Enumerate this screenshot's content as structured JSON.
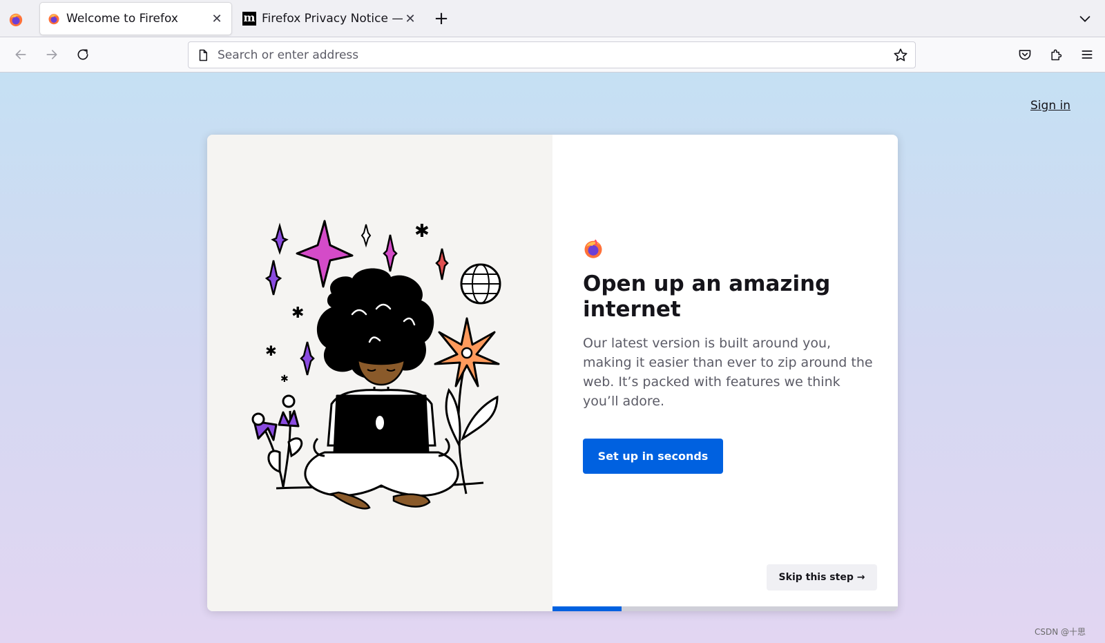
{
  "tabs": [
    {
      "title": "Welcome to Firefox",
      "favicon": "firefox-icon",
      "active": true
    },
    {
      "title": "Firefox Privacy Notice — Mozilla",
      "favicon": "mozilla-m-icon",
      "favicon_text": "m",
      "active": false
    }
  ],
  "toolbar": {
    "address_placeholder": "Search or enter address"
  },
  "page": {
    "sign_in": "Sign in",
    "headline": "Open up an amazing internet",
    "body": "Our latest version is built around you, making it easier than ever to zip around the web. It’s packed with features we think you’ll adore.",
    "primary_button": "Set up in seconds",
    "skip_button": "Skip this step →",
    "progress": 0.2
  },
  "watermark": "CSDN @十思",
  "colors": {
    "accent": "#0061e0",
    "illustration_pink": "#d44bc8",
    "illustration_purple": "#8a4be0",
    "illustration_orange": "#ff9a5c",
    "illustration_skin": "#8a5a2a"
  }
}
